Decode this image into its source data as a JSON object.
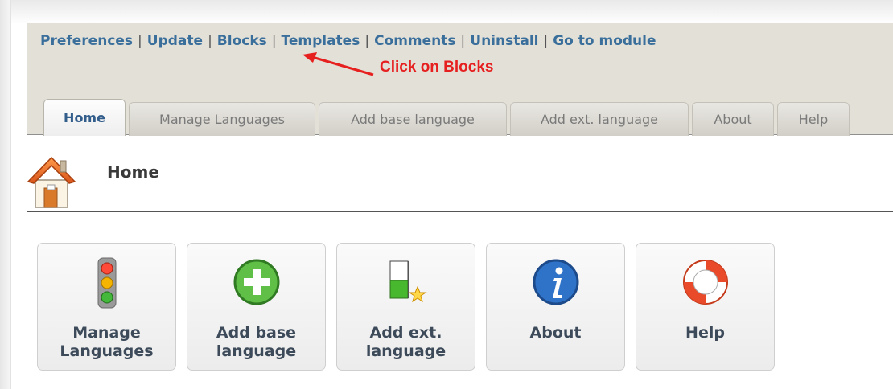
{
  "top_links": [
    "Preferences",
    "Update",
    "Blocks",
    "Templates",
    "Comments",
    "Uninstall",
    "Go to module"
  ],
  "separator": "|",
  "annotation": {
    "text": "Click on Blocks",
    "color": "#e61f1f"
  },
  "tabs": [
    {
      "label": "Home",
      "active": true
    },
    {
      "label": "Manage Languages",
      "active": false
    },
    {
      "label": "Add base language",
      "active": false
    },
    {
      "label": "Add ext. language",
      "active": false
    },
    {
      "label": "About",
      "active": false
    },
    {
      "label": "Help",
      "active": false
    }
  ],
  "page": {
    "title": "Home",
    "title_icon": "home-icon"
  },
  "tiles": [
    {
      "label": "Manage Languages",
      "icon": "traffic-light-icon"
    },
    {
      "label": "Add base language",
      "icon": "green-plus-icon"
    },
    {
      "label": "Add ext. language",
      "icon": "add-extension-icon"
    },
    {
      "label": "About",
      "icon": "info-icon"
    },
    {
      "label": "Help",
      "icon": "lifebuoy-icon"
    }
  ],
  "colors": {
    "link": "#3a6f9c",
    "header_bg": "#e3e0d8",
    "active_tab_text": "#335e8c"
  }
}
